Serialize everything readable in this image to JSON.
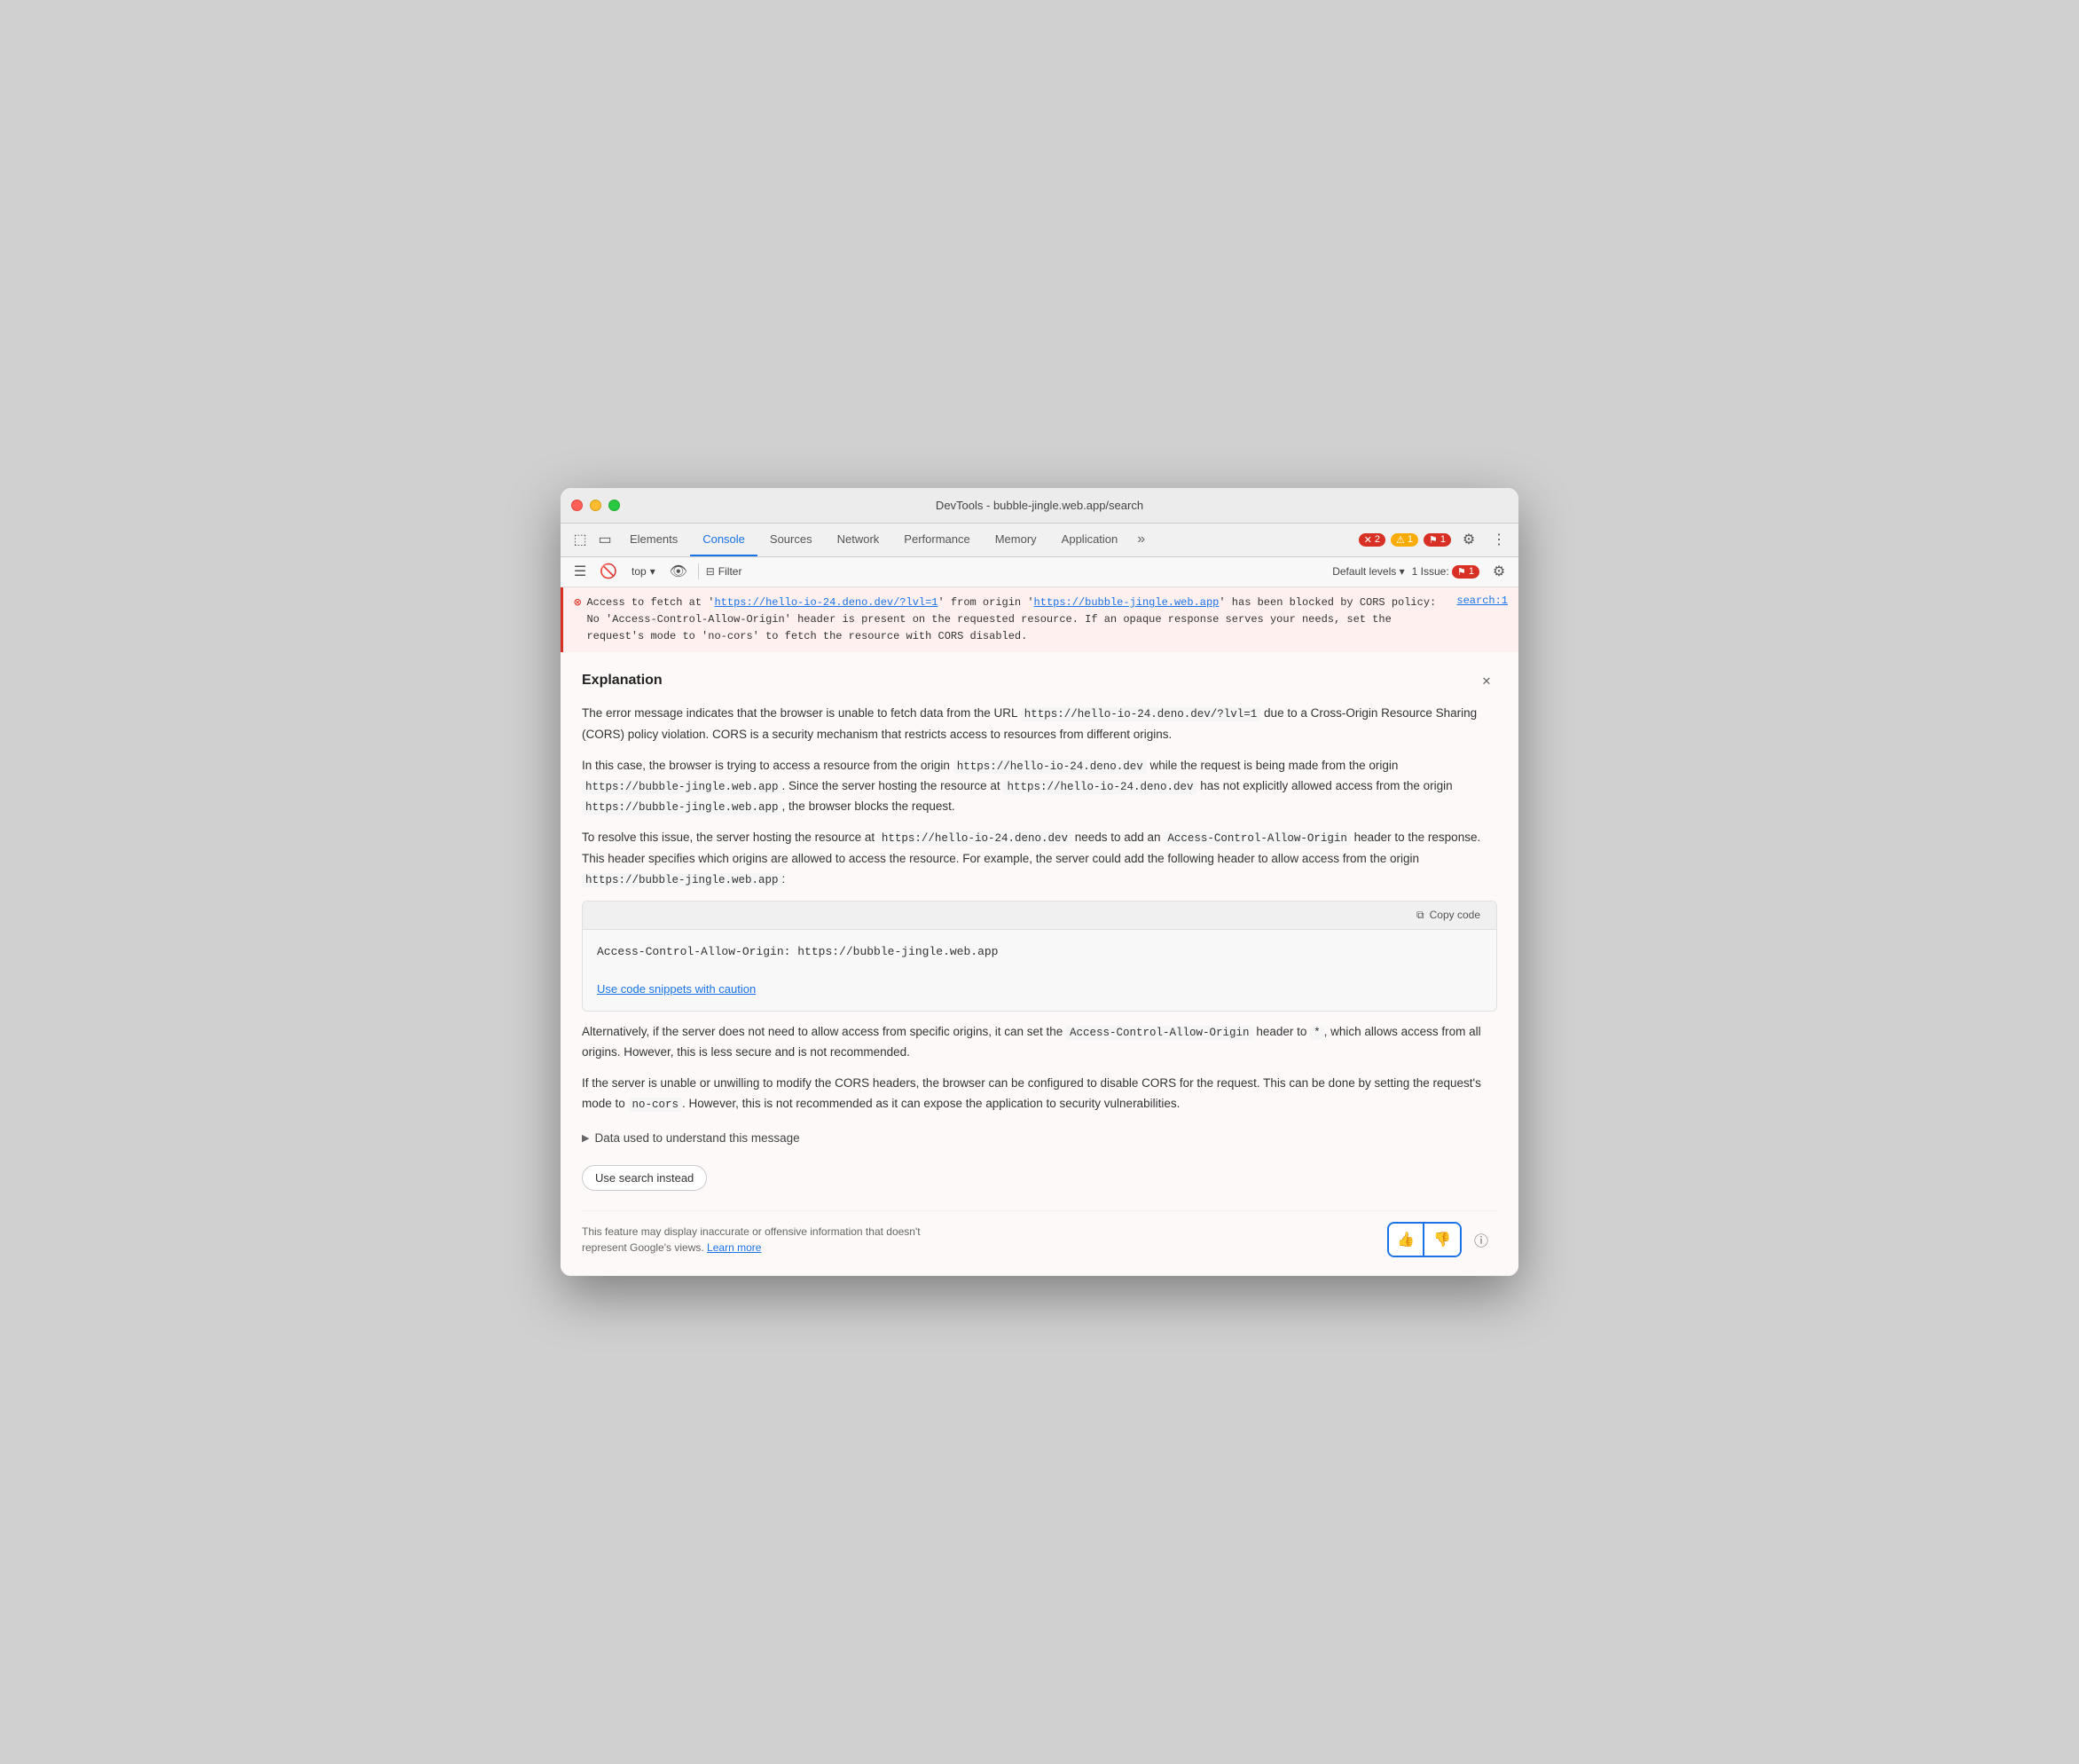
{
  "window": {
    "title": "DevTools - bubble-jingle.web.app/search"
  },
  "tabs": {
    "items": [
      {
        "label": "Elements",
        "active": false
      },
      {
        "label": "Console",
        "active": true
      },
      {
        "label": "Sources",
        "active": false
      },
      {
        "label": "Network",
        "active": false
      },
      {
        "label": "Performance",
        "active": false
      },
      {
        "label": "Memory",
        "active": false
      },
      {
        "label": "Application",
        "active": false
      }
    ],
    "more_label": "»"
  },
  "badges": {
    "error_count": "2",
    "warning_count": "1",
    "issue_count": "1"
  },
  "toolbar": {
    "context_label": "top",
    "filter_label": "Filter",
    "levels_label": "Default levels",
    "issue_label": "1 Issue:",
    "issue_count": "1"
  },
  "error_row": {
    "text_prefix": "Access to fetch at '",
    "url1": "https://hello-io-24.deno.dev/?lvl=1",
    "text_middle": "' from origin '",
    "url2": "https://bubble-jingle.web.app",
    "text_suffix": "' has been blocked by CORS policy: No 'Access-Control-Allow-Origin' header is present on the requested resource. If an opaque response serves your needs, set the request's mode to 'no-cors' to fetch the resource with CORS disabled.",
    "source_link": "search:1"
  },
  "explanation": {
    "title": "Explanation",
    "body1": "The error message indicates that the browser is unable to fetch data from the URL https://hello-io-24.deno.dev/?lvl=1 due to a Cross-Origin Resource Sharing (CORS) policy violation. CORS is a security mechanism that restricts access to resources from different origins.",
    "body2_prefix": "In this case, the browser is trying to access a resource from the origin ",
    "body2_code1": "https://hello-io-24.deno.dev",
    "body2_middle": " while the request is being made from the origin ",
    "body2_code2": "https://bubble-jingle.web.app",
    "body2_middle2": ". Since the server hosting the resource at ",
    "body2_code3": "https://hello-io-24.deno.dev",
    "body2_middle3": " has not explicitly allowed access from the origin ",
    "body2_code4": "https://bubble-jingle.web.app",
    "body2_suffix": ", the browser blocks the request.",
    "body3_prefix": "To resolve this issue, the server hosting the resource at ",
    "body3_code1": "https://hello-io-24.deno.dev",
    "body3_middle": " needs to add an ",
    "body3_code2": "Access-Control-Allow-Origin",
    "body3_middle2": " header to the response. This header specifies which origins are allowed to access the resource. For example, the server could add the following header to allow access from the origin ",
    "body3_code3": "https://bubble-jingle.web.app",
    "body3_suffix": ":",
    "code_snippet": "Access-Control-Allow-Origin: https://bubble-jingle.web.app",
    "caution_label": "Use code snippets with caution",
    "copy_label": "Copy code",
    "body4_prefix": "Alternatively, if the server does not need to allow access from specific origins, it can set the ",
    "body4_code1": "Access-Control-Allow-Origin",
    "body4_middle": " header to ",
    "body4_code2": "*",
    "body4_suffix": ", which allows access from all origins. However, this is less secure and is not recommended.",
    "body5_prefix": "If the server is unable or unwilling to modify the CORS headers, the browser can be configured to disable CORS for the request. This can be done by setting the request's mode to ",
    "body5_code1": "no-cors",
    "body5_suffix": ". However, this is not recommended as it can expose the application to security vulnerabilities.",
    "data_label": "Data used to understand this message",
    "search_instead_label": "Use search instead",
    "feedback_disclaimer": "This feature may display inaccurate or offensive information that doesn't represent Google's views.",
    "learn_more_label": "Learn more"
  }
}
